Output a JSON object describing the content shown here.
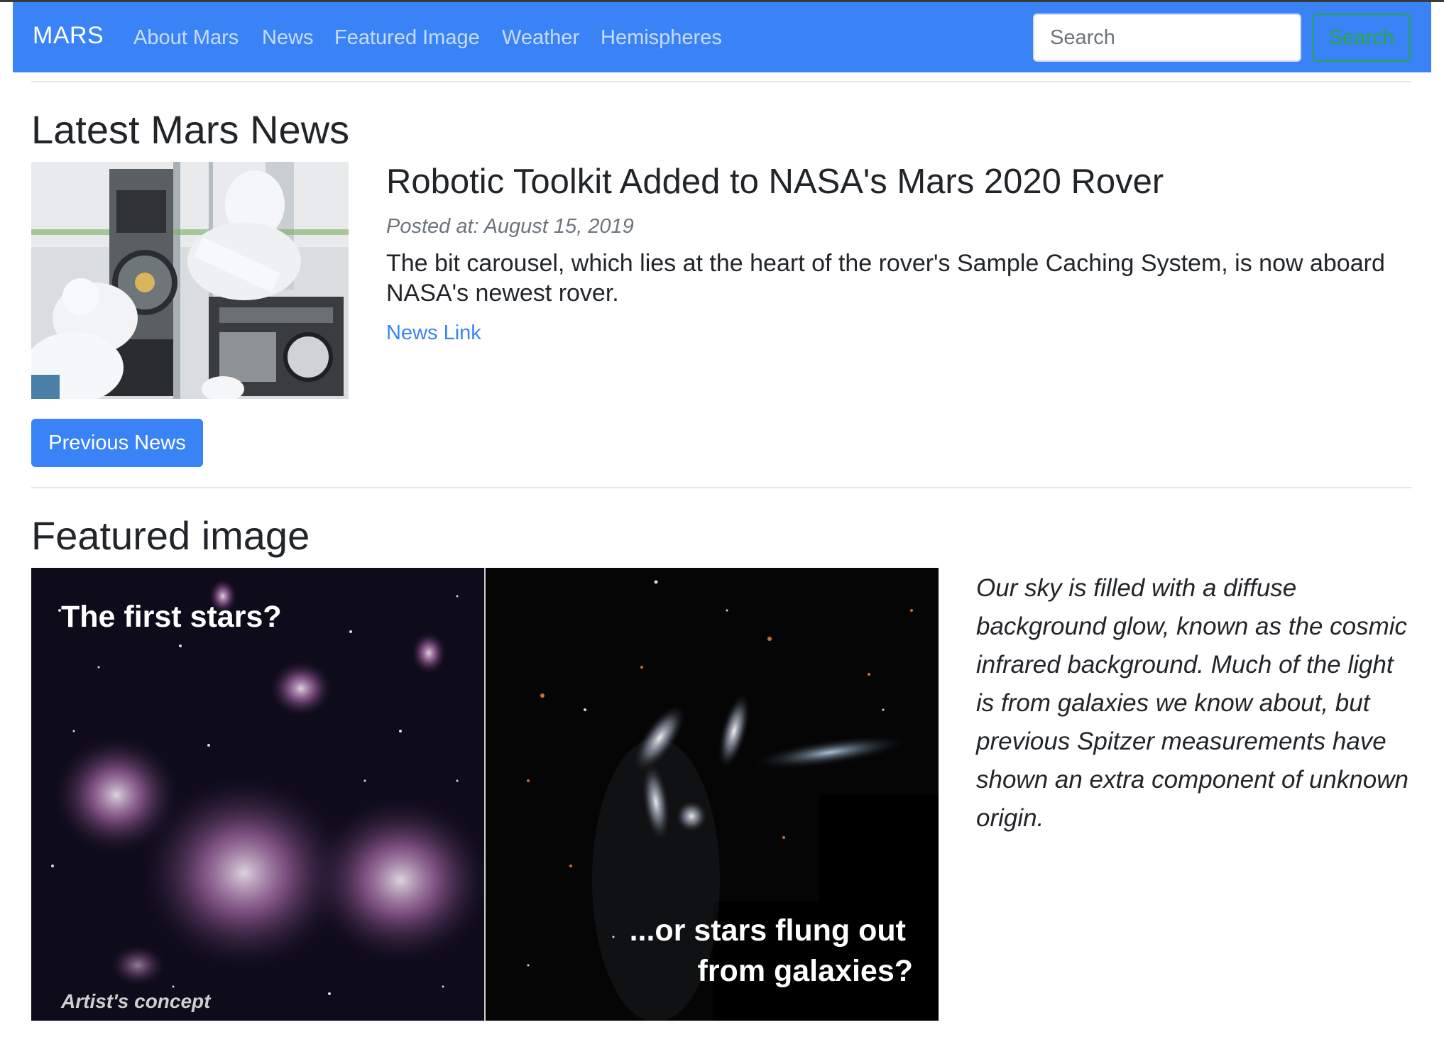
{
  "navbar": {
    "brand": "MARS",
    "items": [
      "About Mars",
      "News",
      "Featured Image",
      "Weather",
      "Hemispheres"
    ],
    "search_placeholder": "Search",
    "search_button": "Search",
    "colors": {
      "bar": "#3a83f6",
      "link": "#c7dcfd",
      "search_button": "#28a745"
    }
  },
  "news_section": {
    "heading": "Latest Mars News",
    "article": {
      "title": "Robotic Toolkit Added to NASA's Mars 2020 Rover",
      "posted": "Posted at: August 15, 2019",
      "teaser": "The bit carousel, which lies at the heart of the rover's Sample Caching System, is now aboard NASA's newest rover.",
      "link_label": "News Link"
    },
    "previous_button": "Previous News"
  },
  "featured_section": {
    "heading": "Featured image",
    "image_captions": {
      "left_top": "The first stars?",
      "left_bottom": "Artist's concept",
      "right_line1": "...or stars flung out",
      "right_line2": "from galaxies?"
    },
    "description": "Our sky is filled with a diffuse background glow, known as the cosmic infrared background. Much of the light is from galaxies we know about, but previous Spitzer measurements have shown an extra component of unknown origin."
  }
}
